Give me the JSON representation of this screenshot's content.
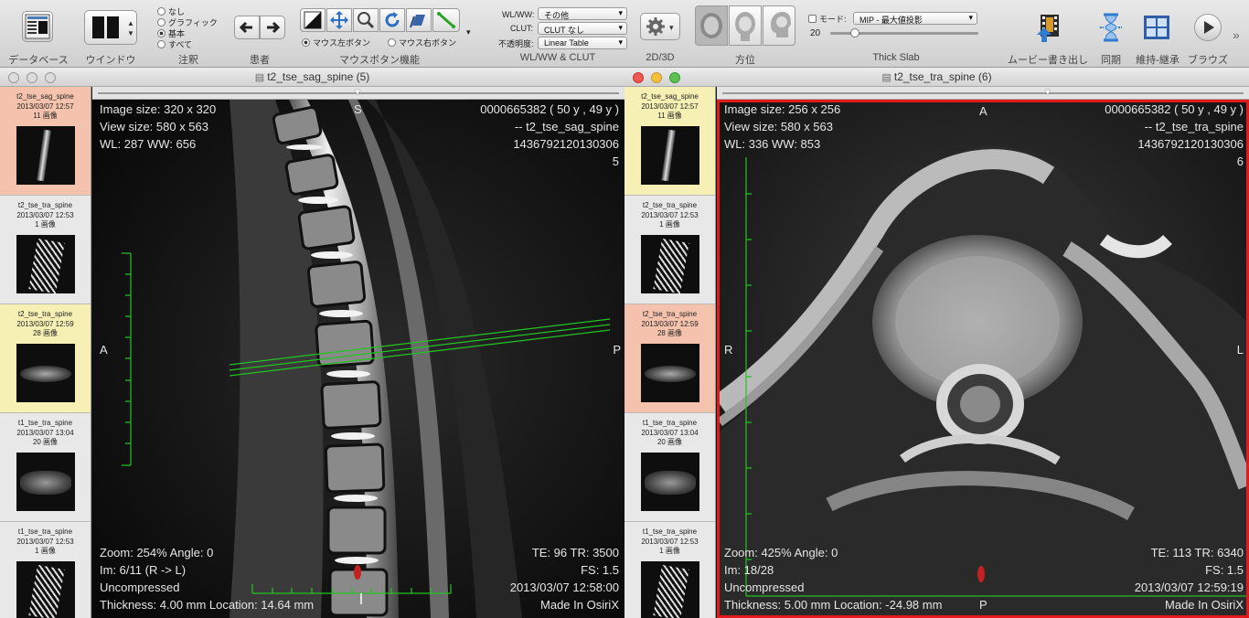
{
  "toolbar": {
    "database_label": "データベース",
    "window_label": "ウインドウ",
    "annotations": {
      "label": "注釈",
      "options": [
        "なし",
        "グラフィック",
        "基本",
        "すべて"
      ],
      "selected": "基本"
    },
    "patient_label": "患者",
    "mouse_function": {
      "label": "マウスボタン機能",
      "left_button": "マウス左ボタン",
      "right_button": "マウス右ボタン"
    },
    "wlww_clut": {
      "label": "WL/WW & CLUT",
      "wlww_label": "WL/WW:",
      "wlww_value": "その他",
      "clut_label": "CLUT:",
      "clut_value": "CLUT なし",
      "opacity_label": "不透明度:",
      "opacity_value": "Linear Table"
    },
    "twod_threed_label": "2D/3D",
    "orientation_label": "方位",
    "thick_slab": {
      "label": "Thick Slab",
      "mode_label": "モード:",
      "mode_value": "MIP - 最大値投影",
      "slab_value": "20"
    },
    "movie_export_label": "ムービー書き出し",
    "sync_label": "同期",
    "keep_inherit_label": "維持-継承",
    "browse_label": "ブラウズ"
  },
  "series_list": [
    {
      "name": "t2_tse_sag_spine",
      "date": "2013/03/07 12:57",
      "count": "11 画像"
    },
    {
      "name": "t2_tse_tra_spine",
      "date": "2013/03/07 12:53",
      "count": "1 画像"
    },
    {
      "name": "t2_tse_tra_spine",
      "date": "2013/03/07 12:59",
      "count": "28 画像"
    },
    {
      "name": "t1_tse_tra_spine",
      "date": "2013/03/07 13:04",
      "count": "20 画像"
    },
    {
      "name": "t1_tse_tra_spine",
      "date": "2013/03/07 12:53",
      "count": "1 画像"
    }
  ],
  "left_window": {
    "title": "t2_tse_sag_spine (5)",
    "overlay": {
      "image_size": "Image size: 320 x 320",
      "view_size": "View size: 580 x 563",
      "wlww": "WL: 287 WW: 656",
      "patient_id": "0000665382 (  50 y ,  49 y )",
      "series_name": "-- t2_tse_sag_spine",
      "study_id": "1436792120130306",
      "series_number": "5",
      "orient_top": "S",
      "orient_left": "A",
      "orient_right": "P",
      "zoom_angle": "Zoom: 254% Angle: 0",
      "image_index": "Im: 6/11  (R -> L)",
      "compression": "Uncompressed",
      "thickness_location": "Thickness: 4.00 mm Location: 14.64 mm",
      "te_tr": "TE:  96 TR:  3500",
      "fs": "FS:  1.5",
      "datetime": "2013/03/07 12:58:00",
      "made_in": "Made In OsiriX"
    }
  },
  "right_window": {
    "title": "t2_tse_tra_spine (6)",
    "overlay": {
      "image_size": "Image size: 256 x 256",
      "view_size": "View size: 580 x 563",
      "wlww": "WL: 336 WW: 853",
      "patient_id": "0000665382 (  50 y ,  49 y )",
      "series_name": "-- t2_tse_tra_spine",
      "study_id": "1436792120130306",
      "series_number": "6",
      "orient_top": "A",
      "orient_left": "R",
      "orient_right": "L",
      "orient_bottom": "P",
      "zoom_angle": "Zoom: 425% Angle: 0",
      "image_index": "Im: 18/28",
      "compression": "Uncompressed",
      "thickness_location": "Thickness: 5.00 mm Location: -24.98 mm",
      "te_tr": "TE:  113 TR:  6340",
      "fs": "FS:  1.5",
      "datetime": "2013/03/07 12:59:19",
      "made_in": "Made In OsiriX"
    }
  },
  "colors": {
    "overlay_text": "#e6e6e6",
    "reference_line": "#22c422",
    "active_border": "#e31a1a",
    "selected_pink": "#f5c3ad",
    "selected_yellow": "#f6f0b4"
  }
}
